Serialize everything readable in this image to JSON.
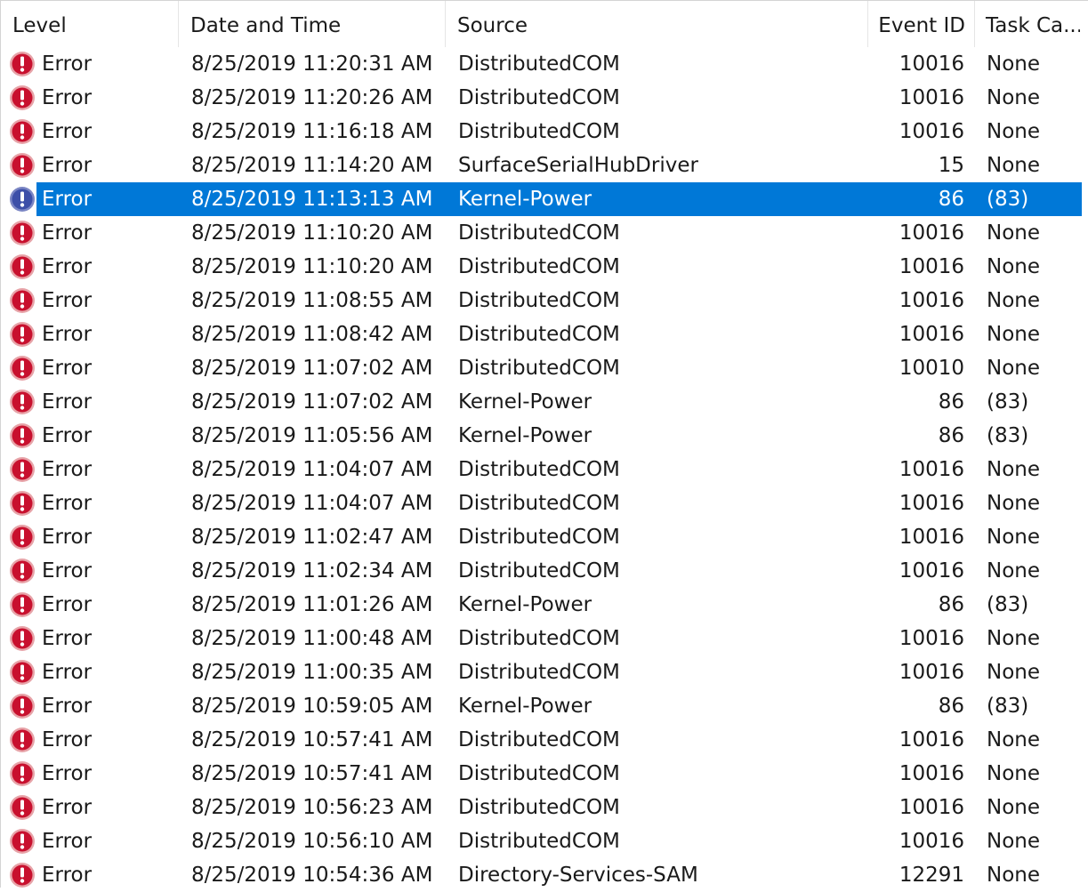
{
  "columns": {
    "level": "Level",
    "date_time": "Date and Time",
    "source": "Source",
    "event_id": "Event ID",
    "task_category": "Task Ca..."
  },
  "selected_index": 4,
  "colors": {
    "selection": "#0078d7",
    "error_icon": "#c8102e"
  },
  "rows": [
    {
      "level": "Error",
      "date_time": "8/25/2019 11:20:31 AM",
      "source": "DistributedCOM",
      "event_id": "10016",
      "task_category": "None"
    },
    {
      "level": "Error",
      "date_time": "8/25/2019 11:20:26 AM",
      "source": "DistributedCOM",
      "event_id": "10016",
      "task_category": "None"
    },
    {
      "level": "Error",
      "date_time": "8/25/2019 11:16:18 AM",
      "source": "DistributedCOM",
      "event_id": "10016",
      "task_category": "None"
    },
    {
      "level": "Error",
      "date_time": "8/25/2019 11:14:20 AM",
      "source": "SurfaceSerialHubDriver",
      "event_id": "15",
      "task_category": "None"
    },
    {
      "level": "Error",
      "date_time": "8/25/2019 11:13:13 AM",
      "source": "Kernel-Power",
      "event_id": "86",
      "task_category": "(83)"
    },
    {
      "level": "Error",
      "date_time": "8/25/2019 11:10:20 AM",
      "source": "DistributedCOM",
      "event_id": "10016",
      "task_category": "None"
    },
    {
      "level": "Error",
      "date_time": "8/25/2019 11:10:20 AM",
      "source": "DistributedCOM",
      "event_id": "10016",
      "task_category": "None"
    },
    {
      "level": "Error",
      "date_time": "8/25/2019 11:08:55 AM",
      "source": "DistributedCOM",
      "event_id": "10016",
      "task_category": "None"
    },
    {
      "level": "Error",
      "date_time": "8/25/2019 11:08:42 AM",
      "source": "DistributedCOM",
      "event_id": "10016",
      "task_category": "None"
    },
    {
      "level": "Error",
      "date_time": "8/25/2019 11:07:02 AM",
      "source": "DistributedCOM",
      "event_id": "10010",
      "task_category": "None"
    },
    {
      "level": "Error",
      "date_time": "8/25/2019 11:07:02 AM",
      "source": "Kernel-Power",
      "event_id": "86",
      "task_category": "(83)"
    },
    {
      "level": "Error",
      "date_time": "8/25/2019 11:05:56 AM",
      "source": "Kernel-Power",
      "event_id": "86",
      "task_category": "(83)"
    },
    {
      "level": "Error",
      "date_time": "8/25/2019 11:04:07 AM",
      "source": "DistributedCOM",
      "event_id": "10016",
      "task_category": "None"
    },
    {
      "level": "Error",
      "date_time": "8/25/2019 11:04:07 AM",
      "source": "DistributedCOM",
      "event_id": "10016",
      "task_category": "None"
    },
    {
      "level": "Error",
      "date_time": "8/25/2019 11:02:47 AM",
      "source": "DistributedCOM",
      "event_id": "10016",
      "task_category": "None"
    },
    {
      "level": "Error",
      "date_time": "8/25/2019 11:02:34 AM",
      "source": "DistributedCOM",
      "event_id": "10016",
      "task_category": "None"
    },
    {
      "level": "Error",
      "date_time": "8/25/2019 11:01:26 AM",
      "source": "Kernel-Power",
      "event_id": "86",
      "task_category": "(83)"
    },
    {
      "level": "Error",
      "date_time": "8/25/2019 11:00:48 AM",
      "source": "DistributedCOM",
      "event_id": "10016",
      "task_category": "None"
    },
    {
      "level": "Error",
      "date_time": "8/25/2019 11:00:35 AM",
      "source": "DistributedCOM",
      "event_id": "10016",
      "task_category": "None"
    },
    {
      "level": "Error",
      "date_time": "8/25/2019 10:59:05 AM",
      "source": "Kernel-Power",
      "event_id": "86",
      "task_category": "(83)"
    },
    {
      "level": "Error",
      "date_time": "8/25/2019 10:57:41 AM",
      "source": "DistributedCOM",
      "event_id": "10016",
      "task_category": "None"
    },
    {
      "level": "Error",
      "date_time": "8/25/2019 10:57:41 AM",
      "source": "DistributedCOM",
      "event_id": "10016",
      "task_category": "None"
    },
    {
      "level": "Error",
      "date_time": "8/25/2019 10:56:23 AM",
      "source": "DistributedCOM",
      "event_id": "10016",
      "task_category": "None"
    },
    {
      "level": "Error",
      "date_time": "8/25/2019 10:56:10 AM",
      "source": "DistributedCOM",
      "event_id": "10016",
      "task_category": "None"
    },
    {
      "level": "Error",
      "date_time": "8/25/2019 10:54:36 AM",
      "source": "Directory-Services-SAM",
      "event_id": "12291",
      "task_category": "None"
    }
  ]
}
